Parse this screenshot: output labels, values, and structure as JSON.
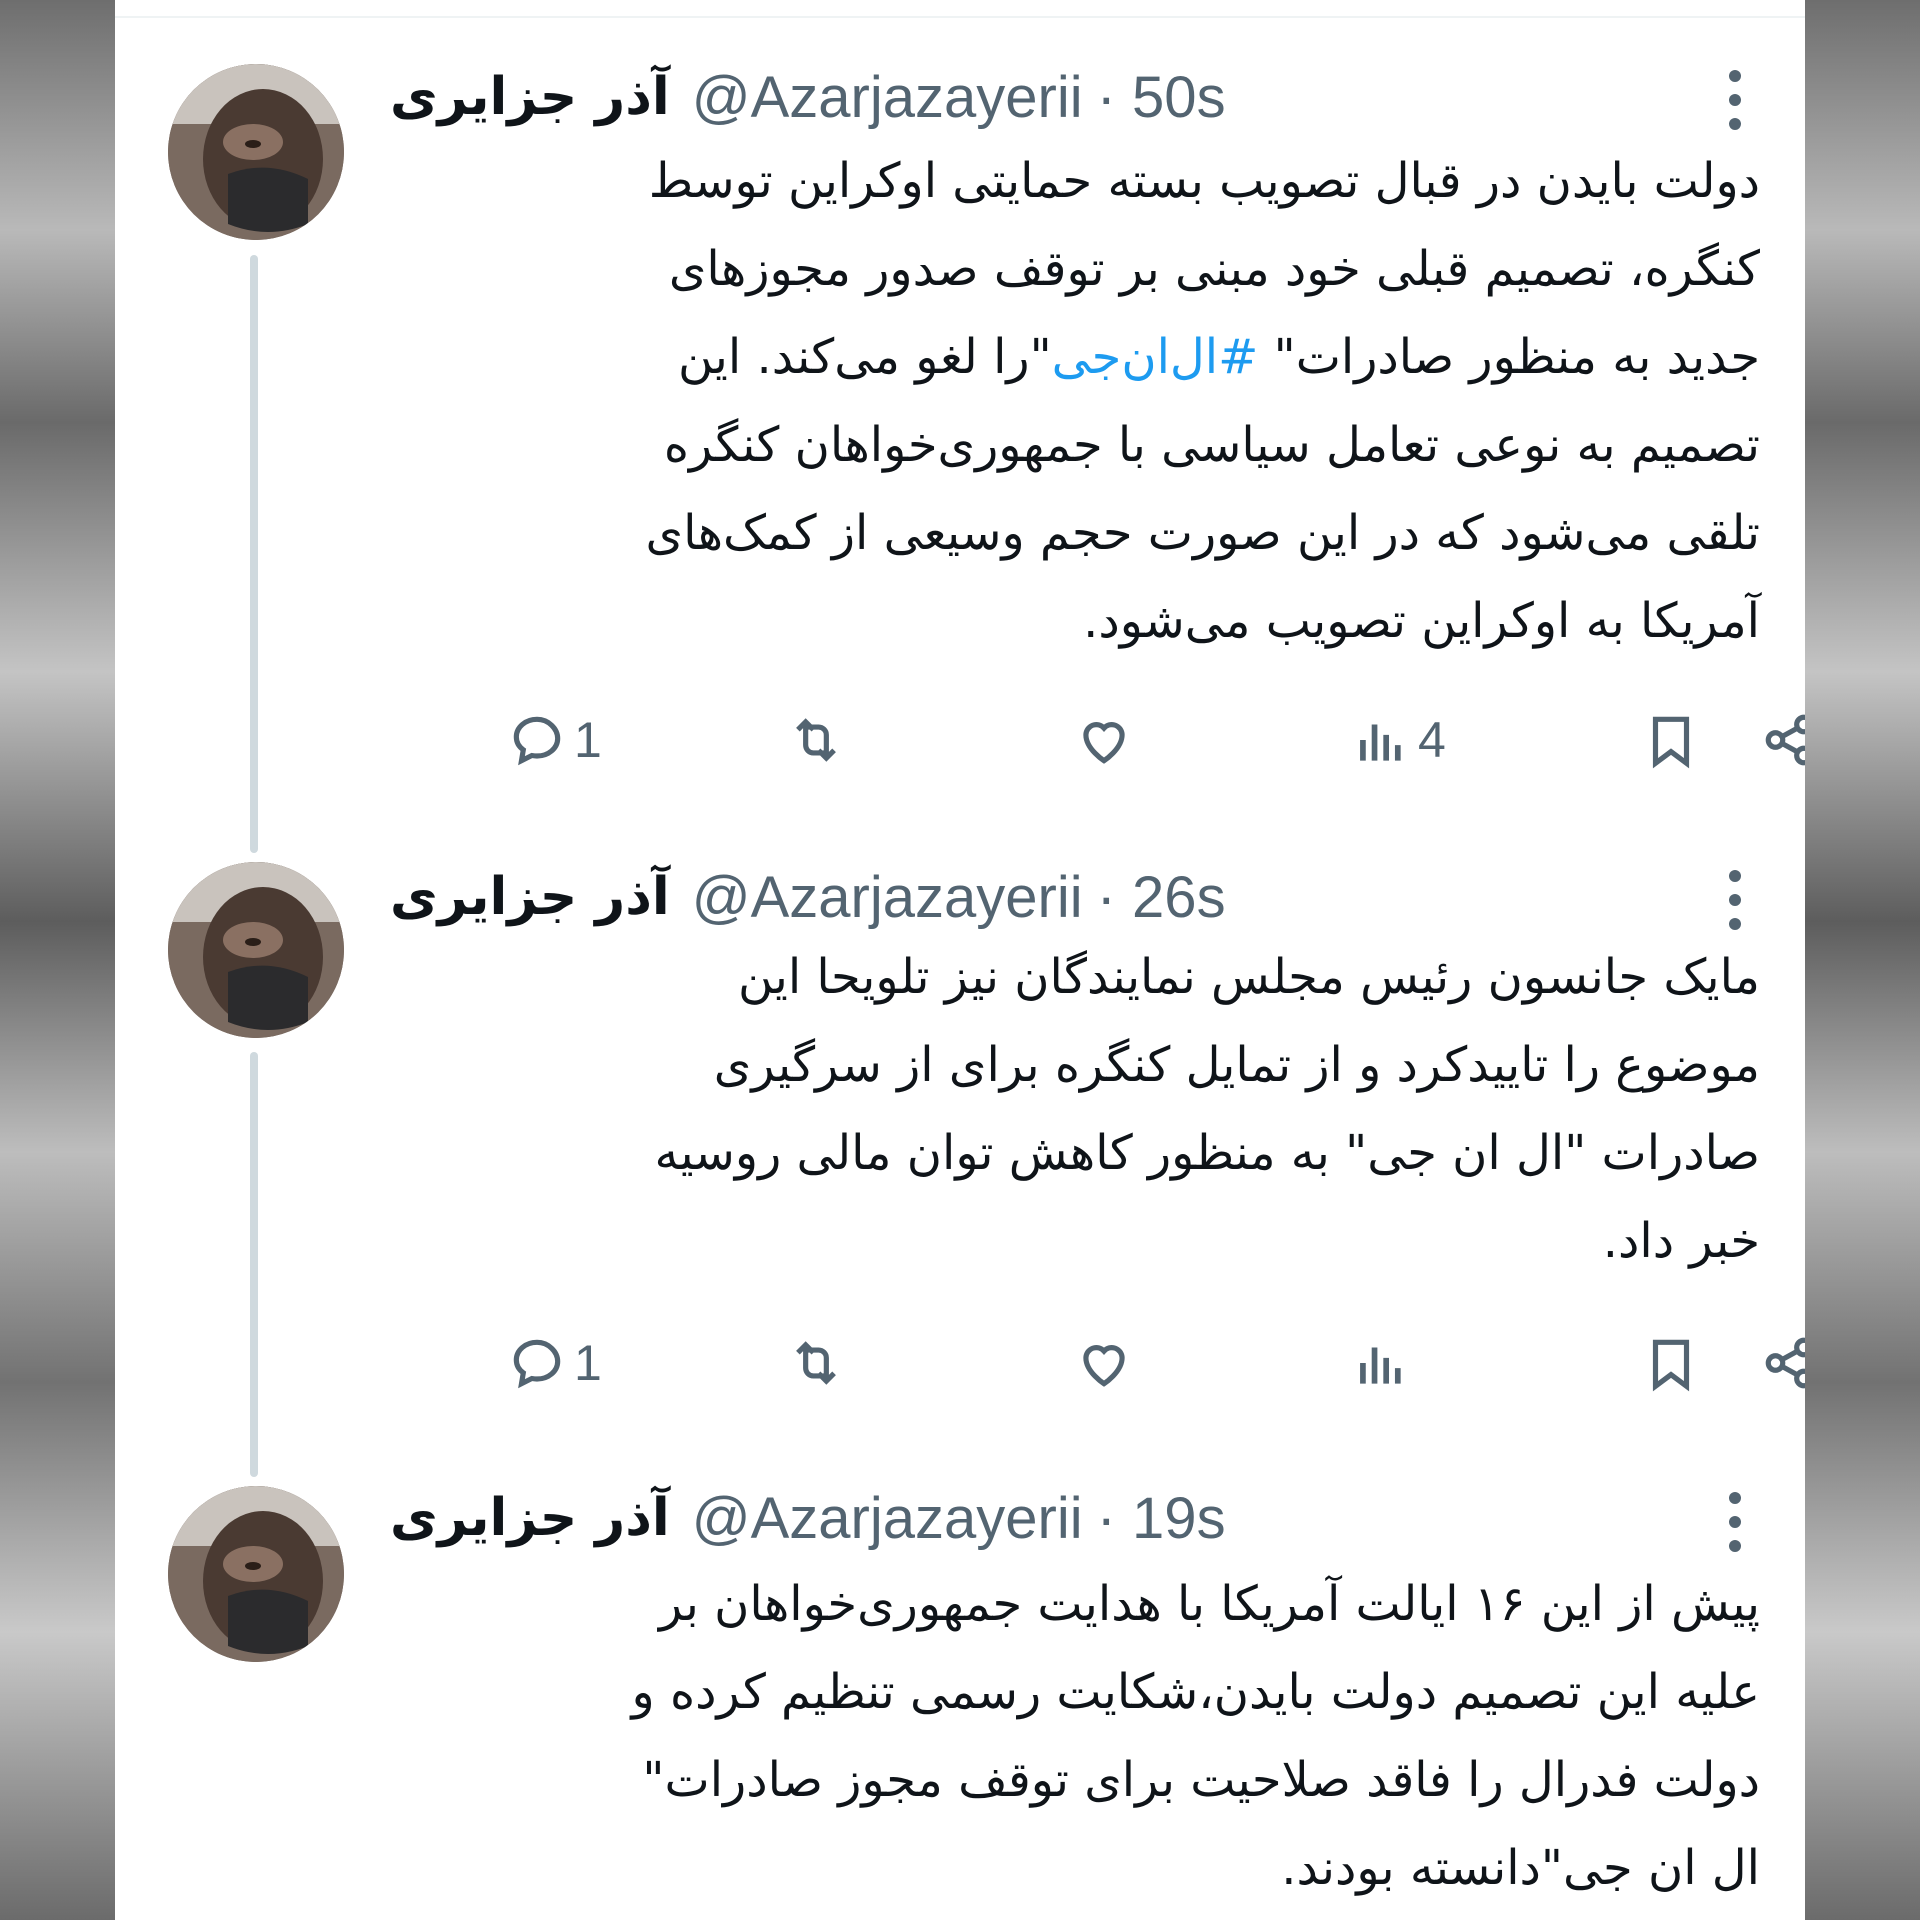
{
  "tweets": [
    {
      "name": "آذر جزایری",
      "handle": "@Azarjazayerii",
      "time": "· 50s",
      "lines": [
        "دولت بایدن در قبال تصویب بسته حمایتی اوکراین توسط",
        "کنگره، تصمیم قبلی خود مبنی بر توقف صدور  مجوزهای",
        "جدید به منظور صادرات\" #ال‌ان‌جی \"را لغو می‌کند. این",
        "تصمیم به نوعی تعامل سیاسی با جمهوری‌خواهان کنگره",
        "تلقی می‌شود که در این صورت حجم وسیعی از کمک‌های",
        "آمریکا به اوکراین تصویب می‌شود."
      ],
      "line3_prefix": "جدید به منظور صادرات\" ",
      "hashtag": "#ال‌ان‌جی",
      "line3_suffix": "\"را لغو می‌کند. این",
      "replies": "1",
      "views": "4"
    },
    {
      "name": "آذر جزایری",
      "handle": "@Azarjazayerii",
      "time": "· 26s",
      "lines": [
        "مایک جانسون رئیس مجلس نمایندگان نیز تلویحا این",
        "موضوع را تاییدکرد و از تمایل کنگره برای از سرگیری",
        "صادرات \"ال ان جی\" به منظور کاهش توان  مالی روسیه",
        "خبر داد."
      ],
      "replies": "1",
      "views": ""
    },
    {
      "name": "آذر جزایری",
      "handle": "@Azarjazayerii",
      "time": "· 19s",
      "lines": [
        "پیش از این ۱۶ ایالت آمریکا با هدایت جمهوری‌خواهان بر",
        "علیه این تصمیم دولت بایدن،شکایت رسمی تنظیم کرده و",
        "دولت فدرال را فاقد صلاحیت برای توقف مجوز صادرات\"",
        "ال ان جی\"دانسته بودند."
      ]
    }
  ],
  "icons": {
    "reply": "reply-icon",
    "retweet": "retweet-icon",
    "like": "like-icon",
    "views": "views-icon",
    "bookmark": "bookmark-icon",
    "share": "share-icon",
    "more": "more-icon"
  },
  "colors": {
    "hashtag": "#1d9bf0",
    "muted": "#536471",
    "text": "#0f1419",
    "thread_line": "#cfd9de"
  }
}
